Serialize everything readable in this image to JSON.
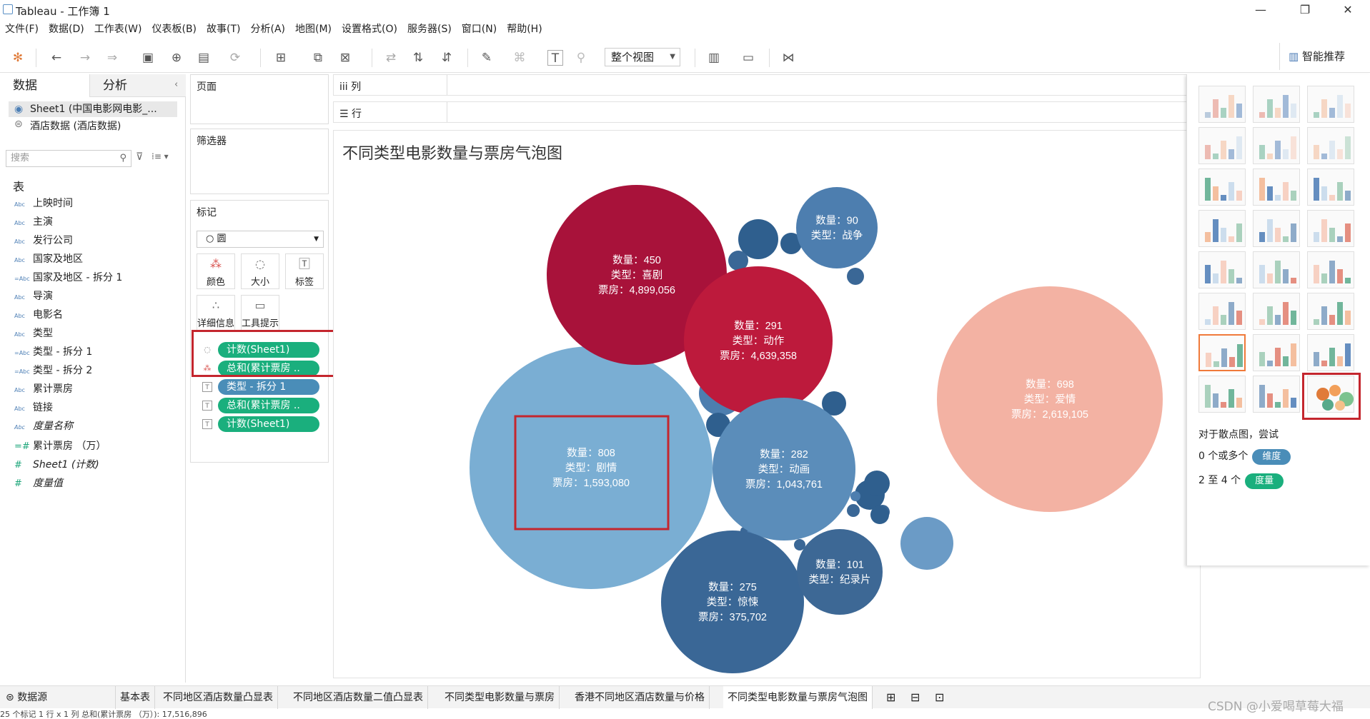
{
  "window": {
    "title": "Tableau - 工作簿 1",
    "minimize": "—",
    "maximize": "❐",
    "close": "✕"
  },
  "menu": [
    "文件(F)",
    "数据(D)",
    "工作表(W)",
    "仪表板(B)",
    "故事(T)",
    "分析(A)",
    "地图(M)",
    "设置格式(O)",
    "服务器(S)",
    "窗口(N)",
    "帮助(H)"
  ],
  "toolbar": {
    "view_select": "整个视图",
    "smart_button": "智能推荐"
  },
  "data_pane": {
    "tab_data": "数据",
    "tab_analysis": "分析",
    "sources": [
      "Sheet1 (中国电影网电影_...",
      "酒店数据 (酒店数据)"
    ],
    "search_placeholder": "搜索",
    "tables_header": "表",
    "fields": [
      {
        "icon": "Abc",
        "name": "上映时间"
      },
      {
        "icon": "Abc",
        "name": "主演"
      },
      {
        "icon": "Abc",
        "name": "发行公司"
      },
      {
        "icon": "Abc",
        "name": "国家及地区"
      },
      {
        "icon": "=Abc",
        "name": "国家及地区 - 拆分 1"
      },
      {
        "icon": "Abc",
        "name": "导演"
      },
      {
        "icon": "Abc",
        "name": "电影名"
      },
      {
        "icon": "Abc",
        "name": "类型"
      },
      {
        "icon": "=Abc",
        "name": "类型 - 拆分 1"
      },
      {
        "icon": "=Abc",
        "name": "类型 - 拆分 2"
      },
      {
        "icon": "Abc",
        "name": "累计票房"
      },
      {
        "icon": "Abc",
        "name": "链接"
      },
      {
        "icon": "Abc",
        "name": "度量名称"
      },
      {
        "icon": "=#",
        "name": "累计票房 （万）"
      },
      {
        "icon": "#",
        "name": "Sheet1 (计数)"
      },
      {
        "icon": "#",
        "name": "度量值"
      }
    ]
  },
  "shelves": {
    "pages": "页面",
    "filters": "筛选器",
    "marks": "标记",
    "mark_type": "○ 圆",
    "mark_buttons": [
      "颜色",
      "大小",
      "标签",
      "详细信息",
      "工具提示"
    ],
    "pills": [
      "计数(Sheet1)",
      "总和(累计票房 ..",
      "类型 - 拆分 1",
      "总和(累计票房 ..",
      "计数(Sheet1)"
    ],
    "columns": "iii 列",
    "rows": "☰ 行"
  },
  "view": {
    "title": "不同类型电影数量与票房气泡图"
  },
  "chart_data": {
    "type": "bubble",
    "title": "不同类型电影数量与票房气泡图",
    "size_measure": "总和(累计票房)",
    "color_measure": "计数(Sheet1)",
    "labeled_bubbles": [
      {
        "label": [
          "数量：808",
          "类型：剧情",
          "票房：1,593,080"
        ],
        "count": 808,
        "genre": "剧情",
        "box_office": 1593080,
        "color": "#7aaed3"
      },
      {
        "label": [
          "数量：698",
          "类型：爱情",
          "票房：2,619,105"
        ],
        "count": 698,
        "genre": "爱情",
        "box_office": 2619105,
        "color": "#f3b2a3"
      },
      {
        "label": [
          "数量：450",
          "类型：喜剧",
          "票房：4,899,056"
        ],
        "count": 450,
        "genre": "喜剧",
        "box_office": 4899056,
        "color": "#a8123a"
      },
      {
        "label": [
          "数量：291",
          "类型：动作",
          "票房：4,639,358"
        ],
        "count": 291,
        "genre": "动作",
        "box_office": 4639358,
        "color": "#bd1a3c"
      },
      {
        "label": [
          "数量：282",
          "类型：动画",
          "票房：1,043,761"
        ],
        "count": 282,
        "genre": "动画",
        "box_office": 1043761,
        "color": "#5b8dba"
      },
      {
        "label": [
          "数量：275",
          "类型：惊悚",
          "票房：375,702"
        ],
        "count": 275,
        "genre": "惊悚",
        "box_office": 375702,
        "color": "#3a6796"
      },
      {
        "label": [
          "数量：101",
          "类型：纪录片"
        ],
        "count": 101,
        "genre": "纪录片",
        "color": "#3d6895"
      },
      {
        "label": [
          "数量：90",
          "类型：战争"
        ],
        "count": 90,
        "genre": "战争",
        "color": "#4d7eaf"
      }
    ],
    "small_bubble_colors": [
      "#2f5f8e",
      "#3a6796",
      "#4d7eaf",
      "#6b9bc6"
    ]
  },
  "smart_panel": {
    "hint": "对于散点图，尝试",
    "row1_text": "0 个或多个",
    "row1_pill": "维度",
    "row2_text": "2 至 4 个",
    "row2_pill": "度量",
    "pill_dim_color": "#4a8db8",
    "pill_measure_color": "#1aaf7d"
  },
  "sheet_tabs": {
    "datasource": "数据源",
    "tabs": [
      "基本表",
      "不同地区酒店数量凸显表",
      "不同地区酒店数量二值凸显表",
      "不同类型电影数量与票房",
      "香港不同地区酒店数量与价格",
      "不同类型电影数量与票房气泡图"
    ]
  },
  "status": "25 个标记    1 行 x 1 列    总和(累计票房 （万）): 17,516,896",
  "watermark": "CSDN @小爱喝草莓大福"
}
